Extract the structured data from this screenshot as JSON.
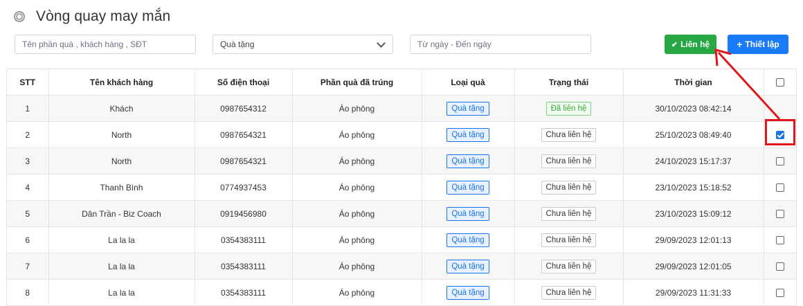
{
  "header": {
    "title": "Vòng quay may mắn",
    "logo_icon": "wheel-icon"
  },
  "filters": {
    "search_placeholder": "Tên phần quà , khách hàng , SĐT",
    "gift_type_selected": "Quà tặng",
    "date_placeholder": "Từ ngày - Đến ngày"
  },
  "buttons": {
    "contact_label": "Liên hệ",
    "contact_icon": "check-icon",
    "setup_label": "Thiết lập",
    "setup_icon": "plus-icon"
  },
  "colors": {
    "contact_button": "#28a745",
    "setup_button": "#1a7bfa",
    "annotation": "#e0161b"
  },
  "table": {
    "columns": [
      "STT",
      "Tên khách hàng",
      "Số điện thoại",
      "Phần quà đã trúng",
      "Loại quà",
      "Trạng thái",
      "Thời gian"
    ],
    "rows": [
      {
        "stt": "1",
        "name": "Khách",
        "phone": "0987654312",
        "prize": "Áo phông",
        "type": "Quà tặng",
        "status": "Đã liên hệ",
        "time": "30/10/2023 08:42:14",
        "checked": false
      },
      {
        "stt": "2",
        "name": "North",
        "phone": "0987654321",
        "prize": "Áo phông",
        "type": "Quà tặng",
        "status": "Chưa liên hệ",
        "time": "25/10/2023 08:49:40",
        "checked": true
      },
      {
        "stt": "3",
        "name": "North",
        "phone": "0987654321",
        "prize": "Áo phông",
        "type": "Quà tặng",
        "status": "Chưa liên hệ",
        "time": "24/10/2023 15:17:37",
        "checked": false
      },
      {
        "stt": "4",
        "name": "Thanh Bình",
        "phone": "0774937453",
        "prize": "Áo phông",
        "type": "Quà tặng",
        "status": "Chưa liên hệ",
        "time": "23/10/2023 15:18:52",
        "checked": false
      },
      {
        "stt": "5",
        "name": "Dân Trần - Biz Coach",
        "phone": "0919456980",
        "prize": "Áo phông",
        "type": "Quà tặng",
        "status": "Chưa liên hệ",
        "time": "23/10/2023 15:09:12",
        "checked": false
      },
      {
        "stt": "6",
        "name": "La la la",
        "phone": "0354383111",
        "prize": "Áo phông",
        "type": "Quà tặng",
        "status": "Chưa liên hệ",
        "time": "29/09/2023 12:01:13",
        "checked": false
      },
      {
        "stt": "7",
        "name": "La la la",
        "phone": "0354383111",
        "prize": "Áo phông",
        "type": "Quà tặng",
        "status": "Chưa liên hệ",
        "time": "29/09/2023 12:01:05",
        "checked": false
      },
      {
        "stt": "8",
        "name": "La la la",
        "phone": "0354383111",
        "prize": "Áo phông",
        "type": "Quà tặng",
        "status": "Chưa liên hệ",
        "time": "29/09/2023 11:31:33",
        "checked": false
      }
    ]
  }
}
